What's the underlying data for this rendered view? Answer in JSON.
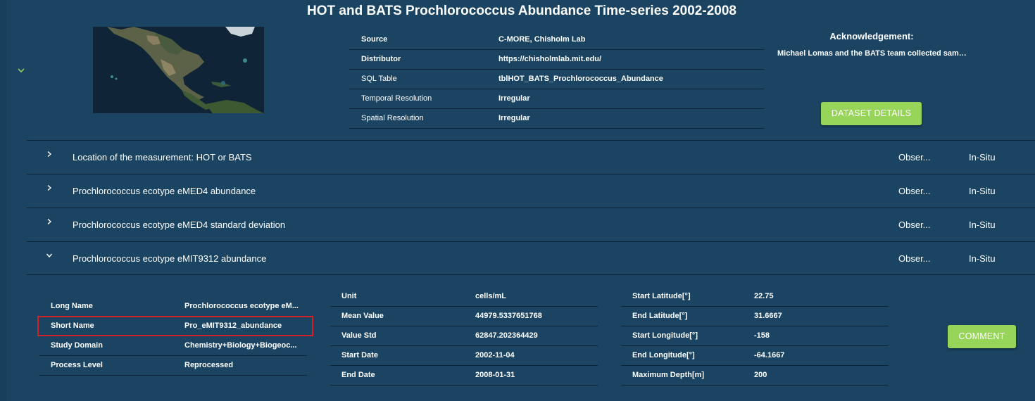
{
  "page": {
    "title": "HOT and BATS Prochlorococcus Abundance Time-series 2002-2008"
  },
  "metadata": [
    {
      "label": "Source",
      "value": "C-MORE, Chisholm Lab"
    },
    {
      "label": "Distributor",
      "value": "https://chisholmlab.mit.edu/"
    },
    {
      "label": "SQL Table",
      "value": "tblHOT_BATS_Prochlorococcus_Abundance"
    },
    {
      "label": "Temporal Resolution",
      "value": "Irregular"
    },
    {
      "label": "Spatial Resolution",
      "value": "Irregular"
    }
  ],
  "acknowledgement": {
    "title": "Acknowledgement:",
    "text": "Michael Lomas and the BATS team collected samp..."
  },
  "buttons": {
    "dataset_details": "DATASET DETAILS",
    "comment": "COMMENT"
  },
  "variables": [
    {
      "name": "Location of the measurement: HOT or BATS",
      "sensor": "Obser...",
      "type": "In-Situ",
      "expanded": false
    },
    {
      "name": "Prochlorococcus ecotype eMED4 abundance",
      "sensor": "Obser...",
      "type": "In-Situ",
      "expanded": false
    },
    {
      "name": "Prochlorococcus ecotype eMED4 standard deviation",
      "sensor": "Obser...",
      "type": "In-Situ",
      "expanded": false
    },
    {
      "name": "Prochlorococcus ecotype eMIT9312 abundance",
      "sensor": "Obser...",
      "type": "In-Situ",
      "expanded": true
    }
  ],
  "details": {
    "names": [
      {
        "label": "Long Name",
        "value": "Prochlorococcus ecotype eM..."
      },
      {
        "label": "Short Name",
        "value": "Pro_eMIT9312_abundance"
      },
      {
        "label": "Study Domain",
        "value": "Chemistry+Biology+Biogeoc..."
      },
      {
        "label": "Process Level",
        "value": "Reprocessed"
      }
    ],
    "stats": [
      {
        "label": "Unit",
        "value": "cells/mL"
      },
      {
        "label": "Mean Value",
        "value": "44979.5337651768"
      },
      {
        "label": "Value Std",
        "value": "62847.202364429"
      },
      {
        "label": "Start Date",
        "value": "2002-11-04"
      },
      {
        "label": "End Date",
        "value": "2008-01-31"
      }
    ],
    "coverage": [
      {
        "label": "Start Latitude[°]",
        "value": "22.75"
      },
      {
        "label": "End Latitude[°]",
        "value": "31.6667"
      },
      {
        "label": "Start Longitude[°]",
        "value": "-158"
      },
      {
        "label": "End Longitude[°]",
        "value": "-64.1667"
      },
      {
        "label": "Maximum Depth[m]",
        "value": "200"
      }
    ]
  },
  "icons": {
    "collapse": "chevron-down-icon",
    "row_collapsed": "chevron-right-icon",
    "row_expanded": "chevron-down-icon"
  },
  "colors": {
    "background": "#1a4462",
    "accent_button": "#97d55a",
    "chevron": "#8dcf5c",
    "highlight": "#d42027"
  }
}
